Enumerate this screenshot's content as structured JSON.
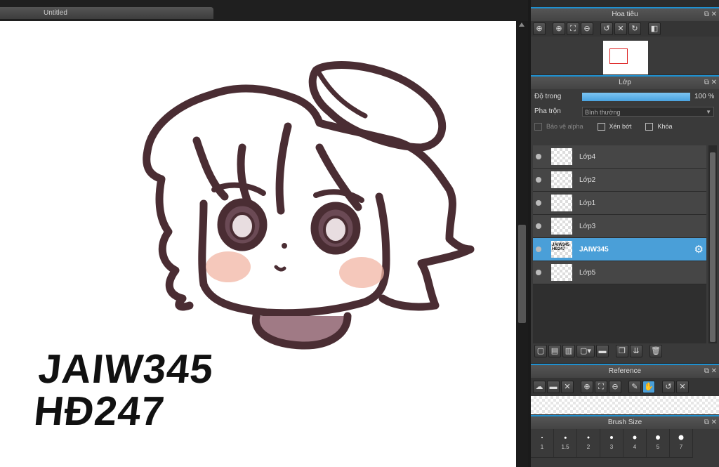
{
  "document": {
    "tab_title": "Untitled"
  },
  "canvas": {
    "signature_lines": [
      "JAIW345",
      "HĐ247"
    ]
  },
  "navigator": {
    "title": "Hoa tiêu",
    "tools": [
      "zoom-in-icon",
      "zoom-in-icon",
      "fit-icon",
      "zoom-out-icon",
      "rotate-left-icon",
      "reset-icon",
      "rotate-right-icon",
      "flip-icon"
    ]
  },
  "layers": {
    "title": "Lớp",
    "opacity_label": "Độ trong",
    "opacity_value": "100 %",
    "opacity_fraction": 1.0,
    "blend_label": "Pha trộn",
    "blend_value": "Bình thường",
    "protect_alpha": "Bảo vệ alpha",
    "clipping": "Xén bớt",
    "lock": "Khóa",
    "items": [
      {
        "name": "Lớp4",
        "selected": false,
        "thumb_text": ""
      },
      {
        "name": "Lớp2",
        "selected": false,
        "thumb_text": ""
      },
      {
        "name": "Lớp1",
        "selected": false,
        "thumb_text": ""
      },
      {
        "name": "Lớp3",
        "selected": false,
        "thumb_text": ""
      },
      {
        "name": "JAIW345",
        "selected": true,
        "thumb_text": "JAIW345 HĐ247"
      },
      {
        "name": "Lớp5",
        "selected": false,
        "thumb_text": ""
      }
    ],
    "accent": "#4a9fd8"
  },
  "reference": {
    "title": "Reference"
  },
  "brush_size": {
    "title": "Brush Size",
    "sizes": [
      "1",
      "1.5",
      "2",
      "3",
      "4",
      "5",
      "7"
    ]
  }
}
